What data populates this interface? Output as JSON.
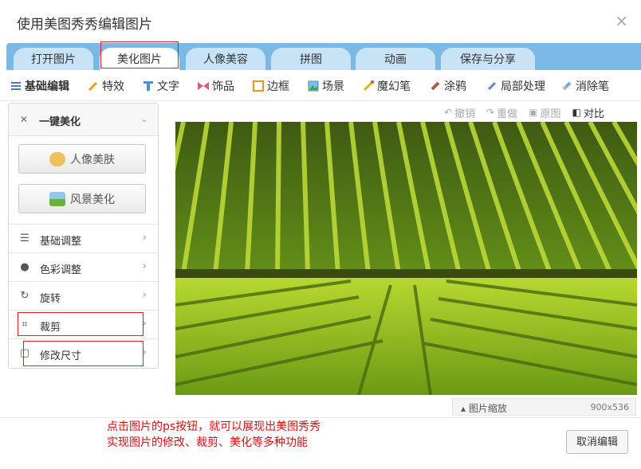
{
  "dialog": {
    "title": "使用美图秀秀编辑图片",
    "close_glyph": "×"
  },
  "tabs": [
    {
      "label": "打开图片"
    },
    {
      "label": "美化图片",
      "active": true
    },
    {
      "label": "人像美容"
    },
    {
      "label": "拼图"
    },
    {
      "label": "动画"
    },
    {
      "label": "保存与分享"
    }
  ],
  "tools": [
    {
      "label": "基础编辑",
      "icon": "sliders-icon",
      "active": true
    },
    {
      "label": "特效",
      "icon": "wand-icon"
    },
    {
      "label": "文字",
      "icon": "text-t-icon"
    },
    {
      "label": "饰品",
      "icon": "bow-icon"
    },
    {
      "label": "边框",
      "icon": "frame-icon"
    },
    {
      "label": "场景",
      "icon": "scene-icon"
    },
    {
      "label": "魔幻笔",
      "icon": "magic-pen-icon"
    },
    {
      "label": "涂鸦",
      "icon": "brush-icon"
    },
    {
      "label": "局部处理",
      "icon": "dropper-icon"
    },
    {
      "label": "消除笔",
      "icon": "eraser-icon"
    }
  ],
  "left_panel": {
    "header": "一键美化",
    "portrait_button": "人像美肤",
    "scenery_button": "风景美化",
    "rows": [
      {
        "label": "基础调整",
        "icon": "sliders-icon"
      },
      {
        "label": "色彩调整",
        "icon": "palette-icon"
      },
      {
        "label": "旋转",
        "icon": "rotate-icon"
      },
      {
        "label": "裁剪",
        "icon": "crop-icon"
      },
      {
        "label": "修改尺寸",
        "icon": "resize-icon"
      }
    ]
  },
  "canvas_toolbar": {
    "undo": "撤销",
    "redo": "重做",
    "original": "原图",
    "compare": "对比"
  },
  "status": {
    "zoom_label": "图片缩放",
    "size": "900x536"
  },
  "annotation": {
    "line1": "点击图片的ps按钮，就可以展现出美图秀秀",
    "line2": "实现图片的修改、裁剪、美化等多种功能"
  },
  "cancel_button": "取消编辑",
  "colors": {
    "tab_bar": "#7ab9e6",
    "tab_inactive": "#c8e3f6",
    "annotation_red": "#d01010"
  }
}
